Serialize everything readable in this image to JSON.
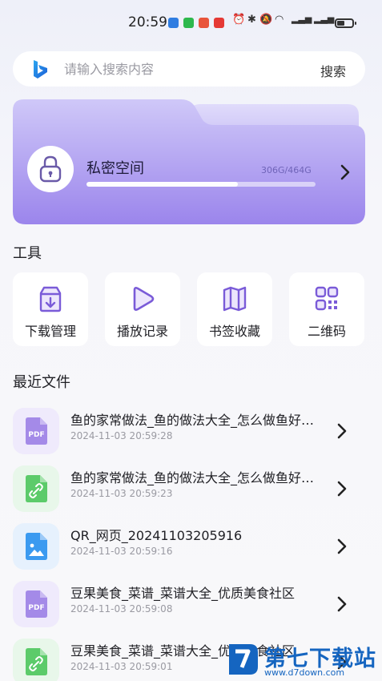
{
  "status_bar": {
    "time": "20:59"
  },
  "search": {
    "placeholder": "请输入搜索内容",
    "button_label": "搜索"
  },
  "private_space": {
    "title": "私密空间",
    "usage_text": "306G/464G",
    "used_fraction": 0.66
  },
  "tools": {
    "section_title": "工具",
    "items": [
      {
        "label": "下载管理",
        "icon": "download-box-icon"
      },
      {
        "label": "播放记录",
        "icon": "play-icon"
      },
      {
        "label": "书签收藏",
        "icon": "bookmark-map-icon"
      },
      {
        "label": "二维码",
        "icon": "qr-code-icon"
      }
    ]
  },
  "recent_files": {
    "section_title": "最近文件",
    "items": [
      {
        "name": "鱼的家常做法_鱼的做法大全_怎么做鱼好吃_下厨房",
        "time": "2024-11-03 20:59:28",
        "type": "pdf",
        "color": "#7a5bd8"
      },
      {
        "name": "鱼的家常做法_鱼的做法大全_怎么做鱼好吃_下厨房",
        "time": "2024-11-03 20:59:23",
        "type": "link",
        "color": "#4ec25a"
      },
      {
        "name": "QR_网页_20241103205916",
        "time": "2024-11-03 20:59:16",
        "type": "image",
        "color": "#3b9af0"
      },
      {
        "name": "豆果美食_菜谱_菜谱大全_优质美食社区",
        "time": "2024-11-03 20:59:08",
        "type": "pdf",
        "color": "#7a5bd8"
      },
      {
        "name": "豆果美食_菜谱_菜谱大全_优质美食社区",
        "time": "2024-11-03 20:59:01",
        "type": "link",
        "color": "#4ec25a"
      }
    ]
  },
  "watermark": {
    "text": "第七下载站",
    "url": "www.d7down.com"
  },
  "colors": {
    "accent": "#7a5bd8",
    "folder_top": "#c8c1f6",
    "folder_bottom": "#9a84ea"
  }
}
